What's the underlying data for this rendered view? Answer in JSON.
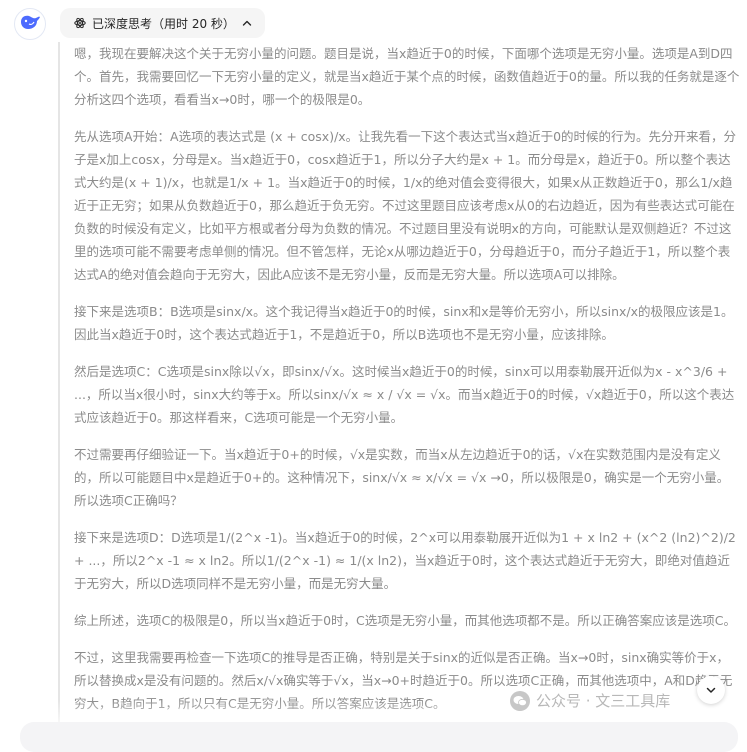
{
  "header": {
    "think_label": "已深度思考（用时 20 秒）",
    "avatar_icon": "deepseek-whale-icon",
    "think_icon": "atom-icon",
    "toggle_icon": "chevron-up-icon"
  },
  "thought": {
    "paragraphs": [
      "嗯，我现在要解决这个关于无穷小量的问题。题目是说，当x趋近于0的时候，下面哪个选项是无穷小量。选项是A到D四个。首先，我需要回忆一下无穷小量的定义，就是当x趋近于某个点的时候，函数值趋近于0的量。所以我的任务就是逐个分析这四个选项，看看当x→0时，哪一个的极限是0。",
      "先从选项A开始：A选项的表达式是 (x + cosx)/x。让我先看一下这个表达式当x趋近于0的时候的行为。先分开来看，分子是x加上cosx，分母是x。当x趋近于0，cosx趋近于1，所以分子大约是x + 1。而分母是x，趋近于0。所以整个表达式大约是(x + 1)/x，也就是1/x + 1。当x趋近于0的时候，1/x的绝对值会变得很大，如果x从正数趋近于0，那么1/x趋近于正无穷；如果从负数趋近于0，那么趋近于负无穷。不过这里题目应该考虑x从0的右边趋近，因为有些表达式可能在负数的时候没有定义，比如平方根或者分母为负数的情况。不过题目里没有说明x的方向，可能默认是双侧趋近？不过这里的选项可能不需要考虑单侧的情况。但不管怎样，无论x从哪边趋近于0，分母趋近于0，而分子趋近于1，所以整个表达式A的绝对值会趋向于无穷大，因此A应该不是无穷小量，反而是无穷大量。所以选项A可以排除。",
      "接下来是选项B：B选项是sinx/x。这个我记得当x趋近于0的时候，sinx和x是等价无穷小，所以sinx/x的极限应该是1。因此当x趋近于0时，这个表达式趋近于1，不是趋近于0，所以B选项也不是无穷小量，应该排除。",
      "然后是选项C：C选项是sinx除以√x，即sinx/√x。这时候当x趋近于0的时候，sinx可以用泰勒展开近似为x - x^3/6 + ...，所以当x很小时，sinx大约等于x。所以sinx/√x ≈ x / √x = √x。而当x趋近于0的时候，√x趋近于0，所以这个表达式应该趋近于0。那这样看来，C选项可能是一个无穷小量。",
      "不过需要再仔细验证一下。当x趋近于0+的时候，√x是实数，而当x从左边趋近于0的话，√x在实数范围内是没有定义的，所以可能题目中x是趋近于0+的。这种情况下，sinx/√x ≈ x/√x = √x →0，所以极限是0，确实是一个无穷小量。所以选项C正确吗？",
      "接下来是选项D：D选项是1/(2^x -1)。当x趋近于0的时候，2^x可以用泰勒展开近似为1 + x ln2 + (x^2 (ln2)^2)/2 + ...，所以2^x -1 ≈ x ln2。所以1/(2^x -1) ≈ 1/(x ln2)，当x趋近于0时，这个表达式趋近于无穷大，即绝对值趋近于无穷大，所以D选项同样不是无穷小量，而是无穷大量。",
      "综上所述，选项C的极限是0，所以当x趋近于0时，C选项是无穷小量，而其他选项都不是。所以正确答案应该是选项C。",
      "不过，这里我需要再检查一下选项C的推导是否正确，特别是关于sinx的近似是否正确。当x→0时，sinx确实等价于x，所以替换成x是没有问题的。然后x/√x确实等于√x，当x→0+时趋近于0。所以选项C正确，而其他选项中，A和D趋于无穷大，B趋向于1，所以只有C是无穷小量。所以答案应该是选项C。"
    ]
  },
  "watermark": {
    "text": "公众号 · 文三工具库",
    "icon": "wechat-icon"
  },
  "controls": {
    "scroll_icon": "chevron-down-icon"
  }
}
